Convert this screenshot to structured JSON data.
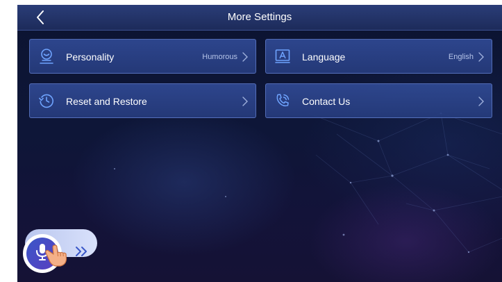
{
  "header": {
    "title": "More Settings"
  },
  "settings": [
    {
      "label": "Personality",
      "value": "Humorous"
    },
    {
      "label": "Language",
      "value": "English"
    },
    {
      "label": "Reset and Restore",
      "value": ""
    },
    {
      "label": "Contact Us",
      "value": ""
    }
  ],
  "icons": {
    "back": "chevron-left-icon",
    "personality": "face-outline-icon",
    "language": "letter-a-box-icon",
    "reset": "history-clock-icon",
    "contact": "phone-call-icon",
    "chevron": "chevron-right-icon",
    "voice": "microphone-icon",
    "hand": "tap-hand-icon",
    "expand": "double-chevron-right-icon"
  },
  "colors": {
    "background": "#0e1638",
    "titlebar": "#2a3d78",
    "card": "#304a94",
    "card_border": "#7896e6",
    "accent": "#4a7cf0",
    "hand": "#f4b088"
  }
}
